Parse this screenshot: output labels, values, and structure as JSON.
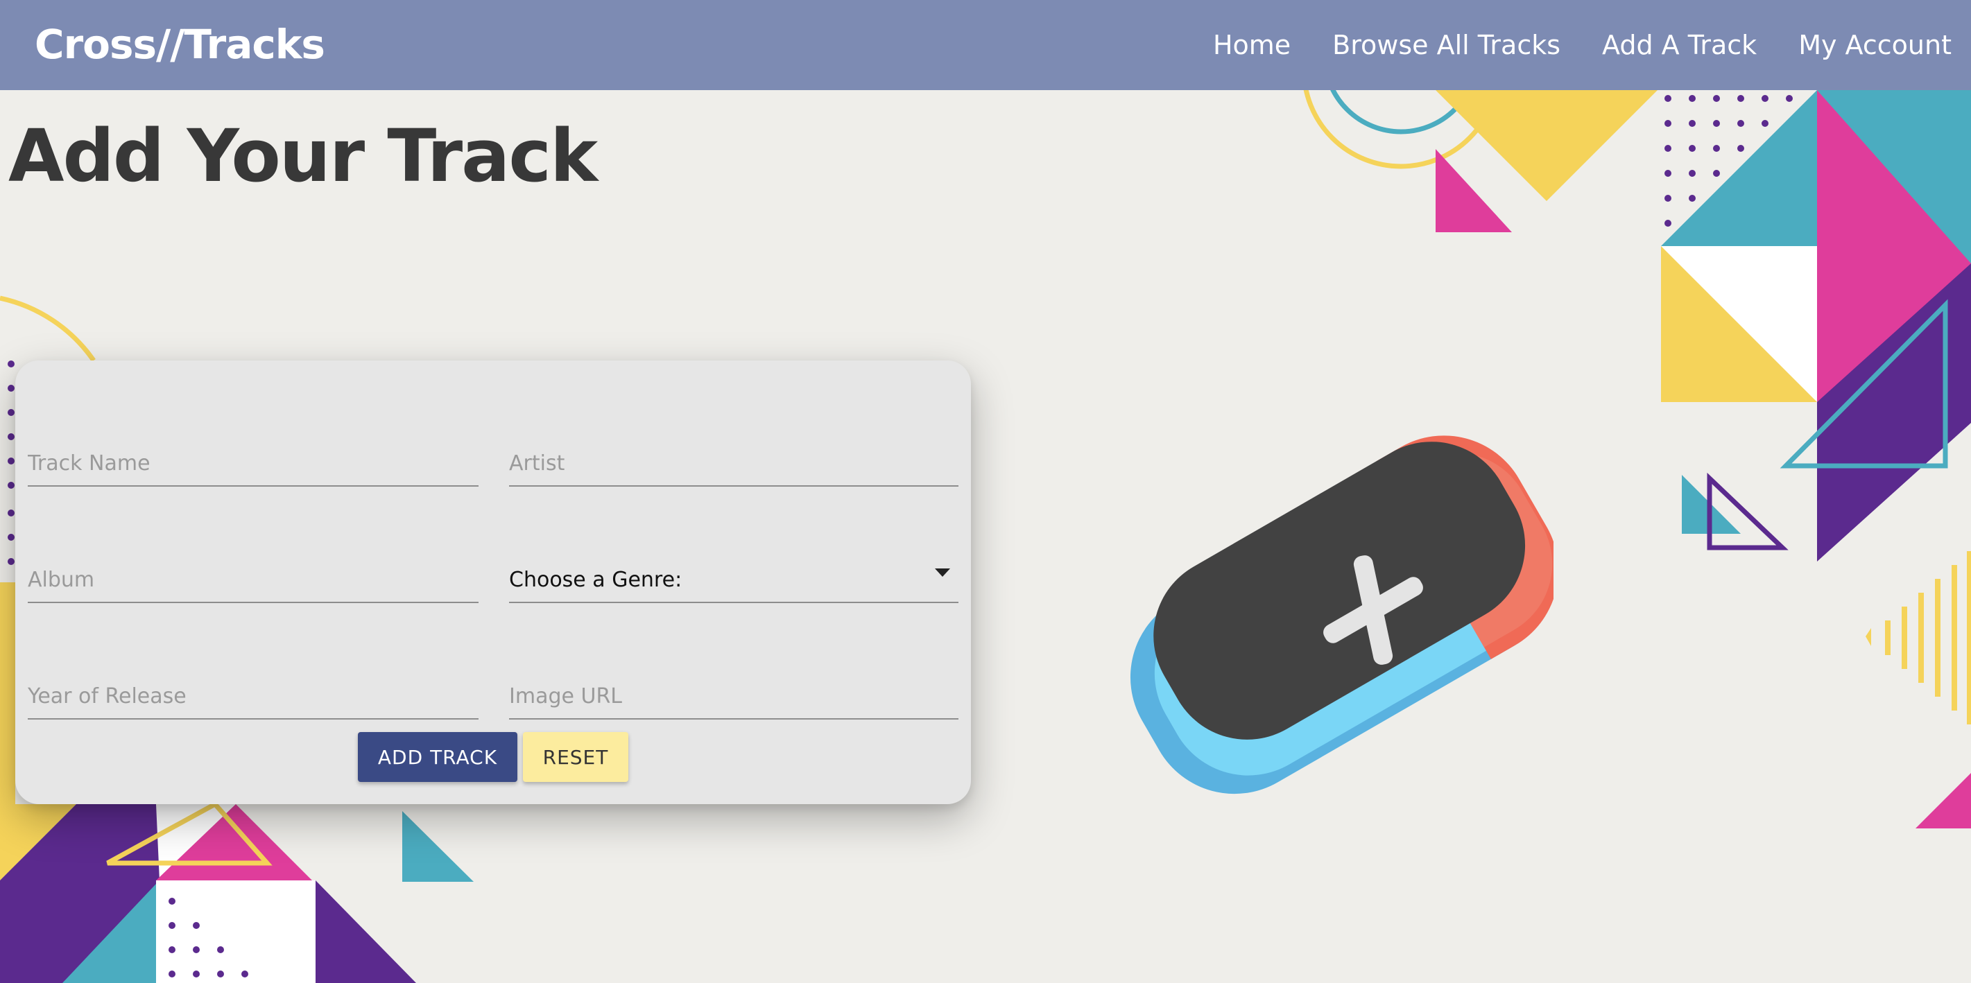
{
  "brand": "Cross//Tracks",
  "nav": {
    "home": "Home",
    "browse": "Browse All Tracks",
    "add": "Add A Track",
    "account": "My Account"
  },
  "page_title": "Add Your Track",
  "form": {
    "track_name_placeholder": "Track Name",
    "artist_placeholder": "Artist",
    "album_placeholder": "Album",
    "genre_label": "Choose a Genre:",
    "year_placeholder": "Year of Release",
    "image_url_placeholder": "Image URL",
    "add_button": "ADD TRACK",
    "reset_button": "RESET"
  },
  "colors": {
    "navbar": "#7d8bb3",
    "background": "#efeeea",
    "card": "#e6e6e6",
    "add_button": "#3a4a85",
    "reset_button": "#fcec9e",
    "accent_yellow": "#f5d35a",
    "accent_teal": "#4bacc0",
    "accent_magenta": "#df3d9b",
    "accent_purple": "#5b2a8e"
  },
  "icons": {
    "hero": "add-plus-icon"
  }
}
